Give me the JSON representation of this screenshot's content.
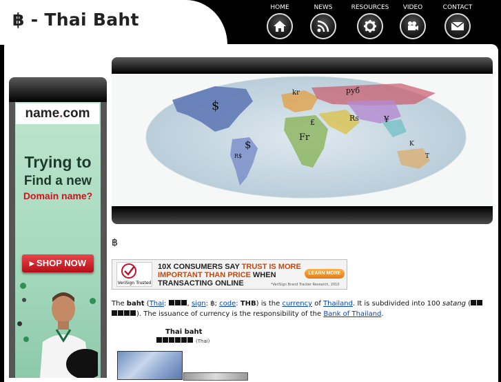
{
  "header": {
    "title": "฿ - Thai Baht",
    "nav": [
      {
        "label": "HOME",
        "icon": "home-icon"
      },
      {
        "label": "NEWS",
        "icon": "rss-icon"
      },
      {
        "label": "RESOURCES",
        "icon": "gear-icon"
      },
      {
        "label": "VIDEO",
        "icon": "video-camera-icon"
      },
      {
        "label": "CONTACT",
        "icon": "mail-icon"
      }
    ]
  },
  "ad": {
    "logo_name": "name",
    "logo_dot": ".",
    "logo_tld": "com",
    "headline1": "Trying to",
    "headline2": "Find a new",
    "headline3": "Domain name?",
    "button": "▸ SHOP NOW"
  },
  "map": {
    "symbols": [
      "$",
      "$",
      "руб",
      "kr",
      "Fr",
      "£",
      "Rs",
      "¥",
      "R$",
      "K",
      "T"
    ]
  },
  "symbol_heading": "฿",
  "banner": {
    "badge": "VeriSign Trusted",
    "line1": "10X CONSUMERS SAY ",
    "line1_highlight": "TRUST IS MORE",
    "line2_highlight": "IMPORTANT THAN PRICE",
    "line2": " WHEN",
    "line3": "TRANSACTING ONLINE",
    "button": "LEARN MORE",
    "source": "*VeriSign Brand Tracker Research, 2010"
  },
  "article": {
    "t1": "The ",
    "baht": "baht",
    "t2": " (",
    "thai_link": "Thai",
    "t3": ": ",
    "t4": ", ",
    "sign_link": "sign",
    "t5": ": ฿; ",
    "code_link": "code",
    "t6": ": ",
    "code": "THB",
    "t7": ") is the ",
    "currency_link": "currency",
    "t8": " of ",
    "thailand_link": "Thailand",
    "t9": ". It is subdivided into 100 ",
    "satang": "satang",
    "t10": " (",
    "t11": "). The issuance of currency is the responsibility of the ",
    "bank_link": "Bank of Thailand",
    "t12": "."
  },
  "infobox": {
    "title": "Thai baht",
    "thai_paren": "(Thai)"
  },
  "colors": {
    "link": "#0645ad",
    "ad_red": "#c8151d",
    "banner_orange": "#c9470a"
  }
}
